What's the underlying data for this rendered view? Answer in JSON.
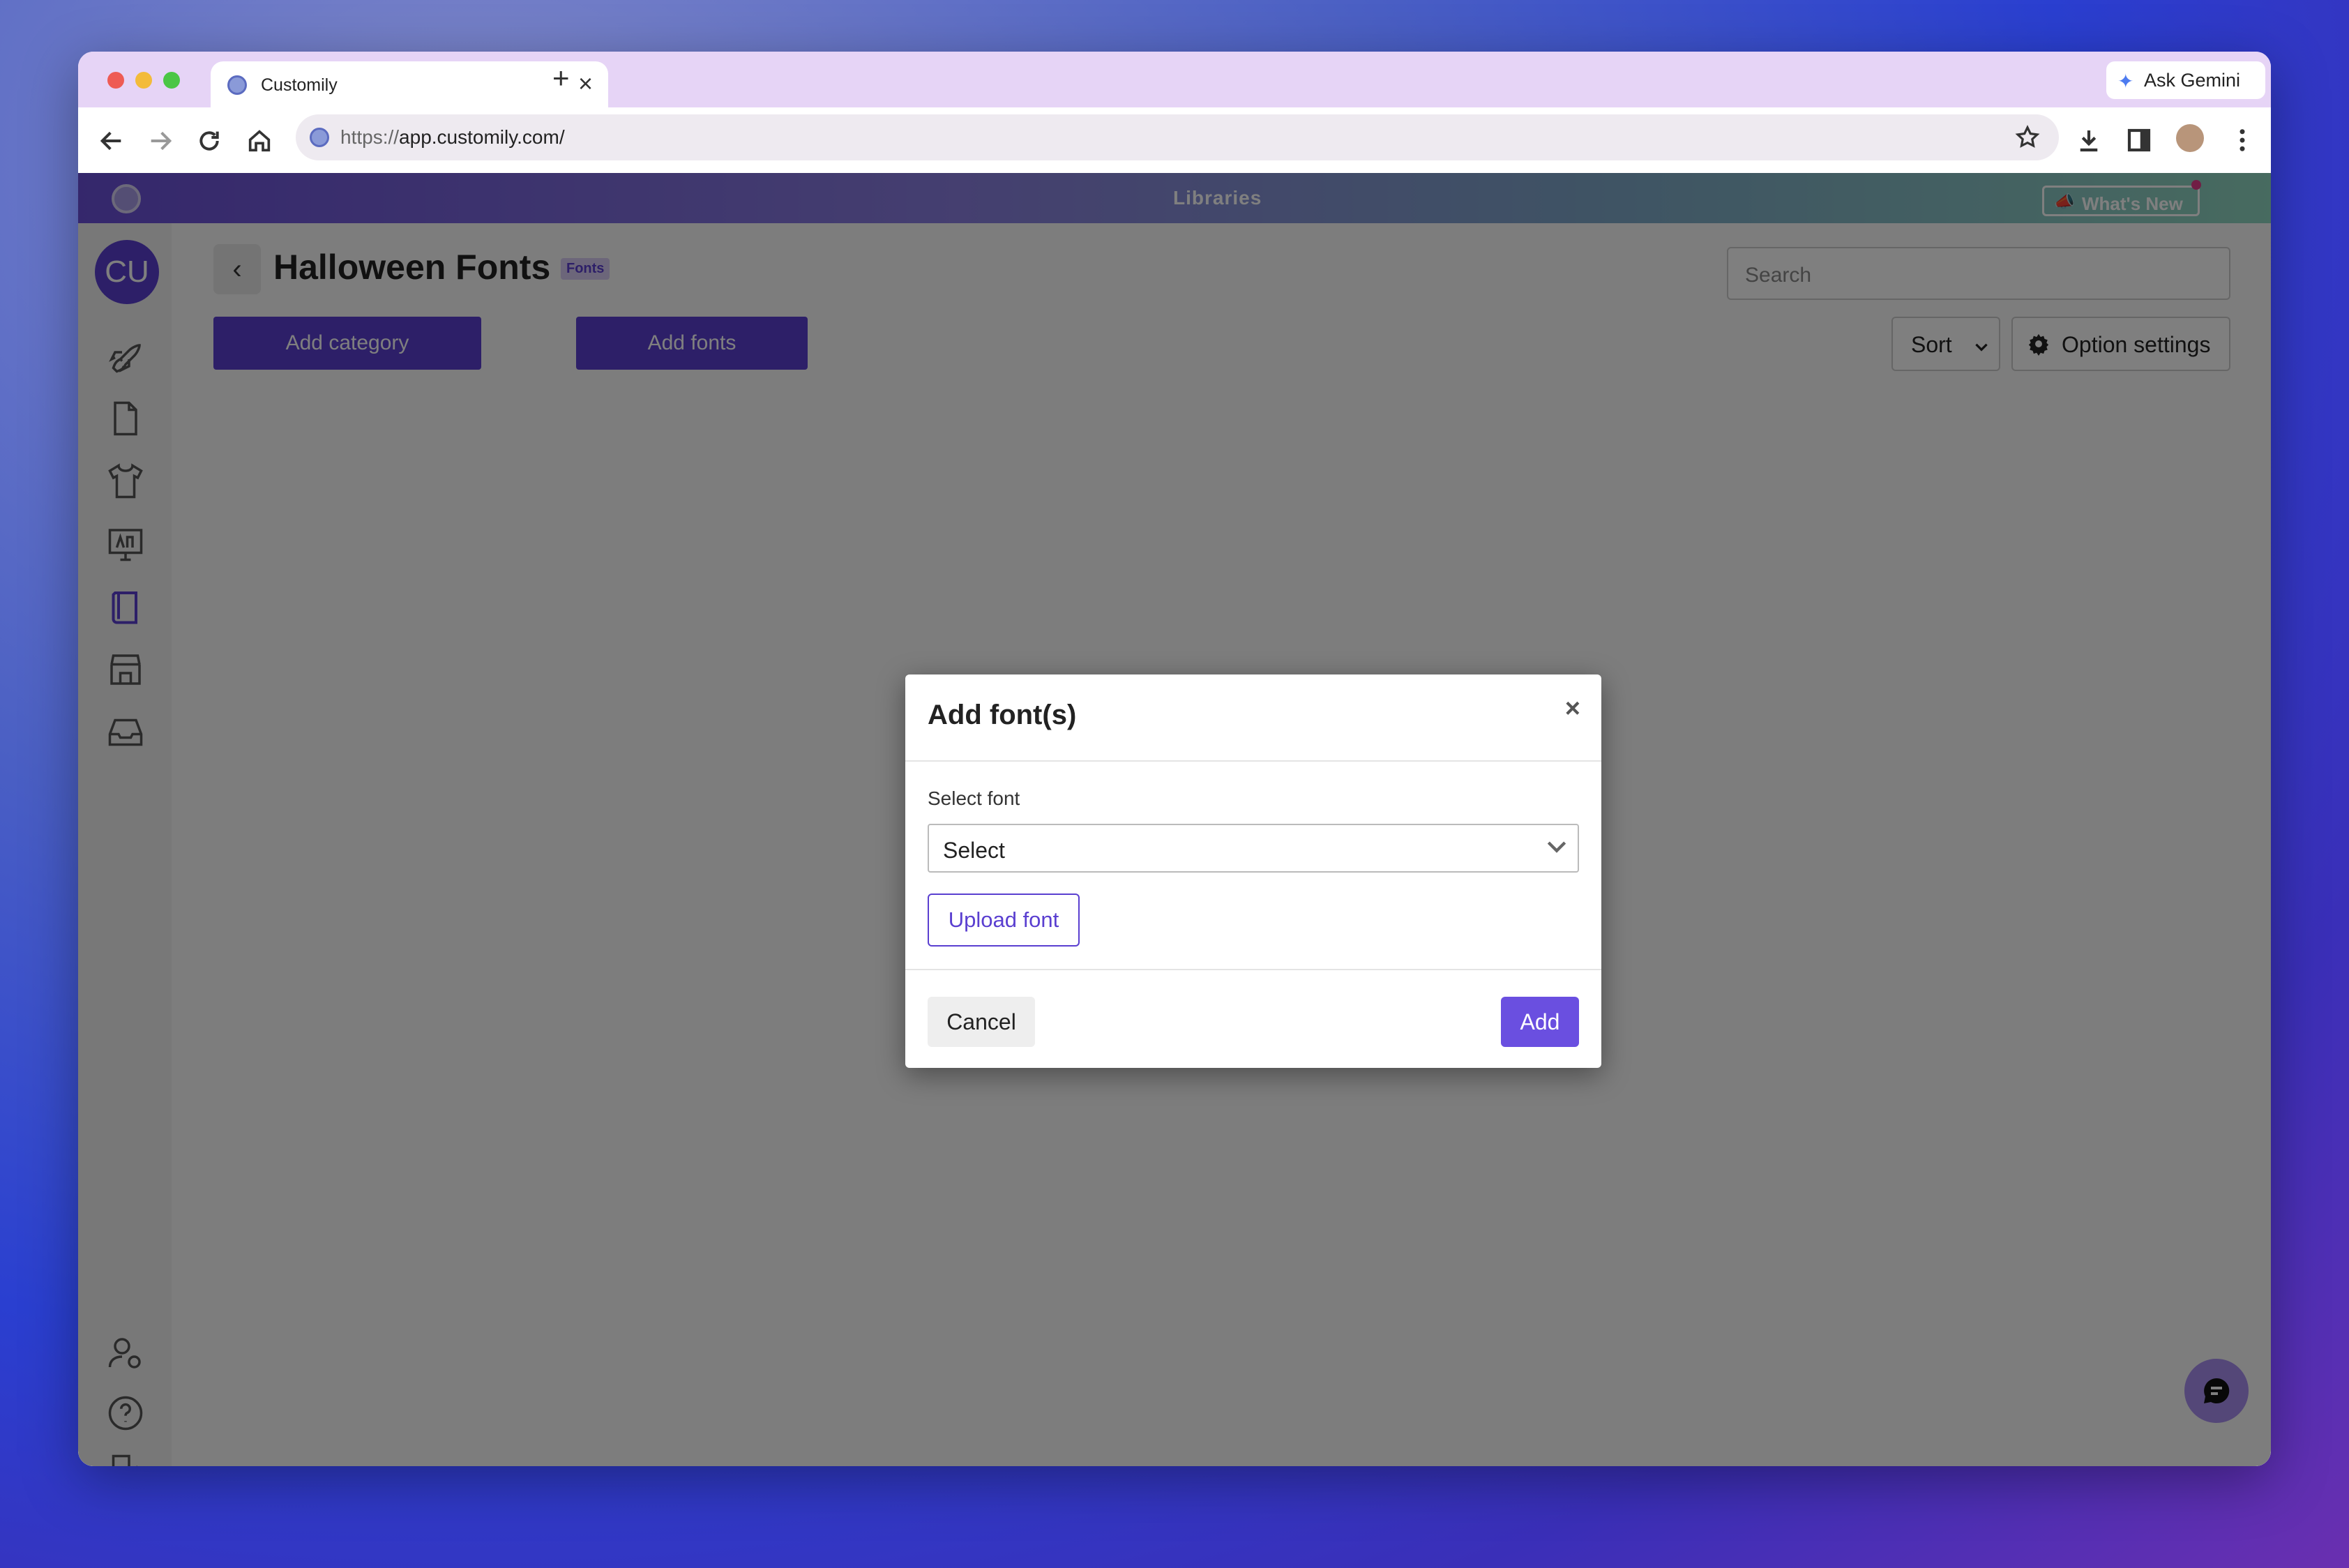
{
  "browser": {
    "tab_title": "Customily",
    "tab_close": "×",
    "new_tab": "+",
    "ask_gemini": "Ask Gemini",
    "url_scheme": "https://",
    "url_host": "app.customily.com/"
  },
  "appbar": {
    "title": "Libraries",
    "whats_new": "What's New"
  },
  "sidebar": {
    "avatar_initials": "CU",
    "icons": [
      "rocket-icon",
      "document-icon",
      "tshirt-icon",
      "monitor-icon",
      "book-icon",
      "store-icon",
      "inbox-icon",
      "user-settings-icon",
      "help-icon",
      "logout-icon"
    ]
  },
  "main": {
    "page_title": "Halloween Fonts",
    "badge": "Fonts",
    "search_placeholder": "Search",
    "add_category": "Add category",
    "add_fonts": "Add fonts",
    "sort": "Sort",
    "option_settings": "Option settings"
  },
  "modal": {
    "title": "Add font(s)",
    "close": "×",
    "select_label": "Select font",
    "select_value": "Select",
    "upload_font": "Upload font",
    "cancel": "Cancel",
    "add": "Add"
  },
  "colors": {
    "accent": "#5a3fd0",
    "tabstrip": "#e6d4f6"
  }
}
